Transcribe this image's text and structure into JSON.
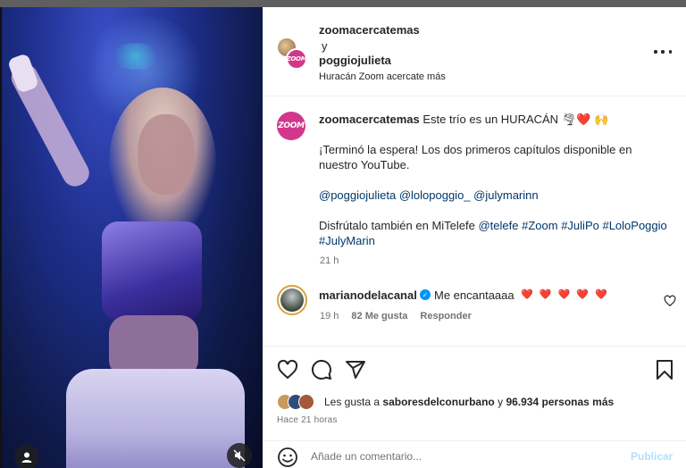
{
  "header": {
    "user1": "zoomacercatemas",
    "and": "y",
    "user2": "poggiojulieta",
    "audio": "Huracán Zoom acercate más"
  },
  "caption": {
    "username": "zoomacercatemas",
    "line1": "Este trío es un HURACÁN 🌪❤️ 🙌",
    "paragraph2": "¡Terminó la espera! Los dos primeros capítulos disponible en nuestro YouTube.",
    "mentions": [
      "@poggiojulieta",
      "@lolopoggio_",
      "@julymarinn"
    ],
    "paragraph4_prefix": "Disfrútalo también en MiTelefe",
    "paragraph4_links": [
      "@telefe",
      "#Zoom",
      "#JuliPo",
      "#LoloPoggio",
      "#JulyMarin"
    ],
    "time": "21 h",
    "avatar_logo": "ZOOM"
  },
  "comment": {
    "username": "marianodelacanal",
    "verified_mark": "✓",
    "text": "Me encantaaaa",
    "hearts": "❤️ ❤️ ❤️ ❤️ ❤️",
    "time": "19 h",
    "likes": "82 Me gusta",
    "reply": "Responder"
  },
  "likes": {
    "prefix": "Les gusta a",
    "user": "saboresdelconurbano",
    "connector": "y",
    "others": "96.934 personas más"
  },
  "timestamp": "Hace 21 horas",
  "add_comment": {
    "placeholder": "Añade un comentario...",
    "publish": "Publicar"
  },
  "colors": {
    "accent_blue": "#0095f6",
    "link": "#00376b",
    "brand_pink": "#d2378b",
    "heart_red": "#e0173b"
  },
  "icons": [
    "user-tag-icon",
    "mute-icon",
    "more-icon",
    "heart-icon",
    "comment-icon",
    "share-icon",
    "bookmark-icon",
    "emoji-icon",
    "verified-icon"
  ]
}
